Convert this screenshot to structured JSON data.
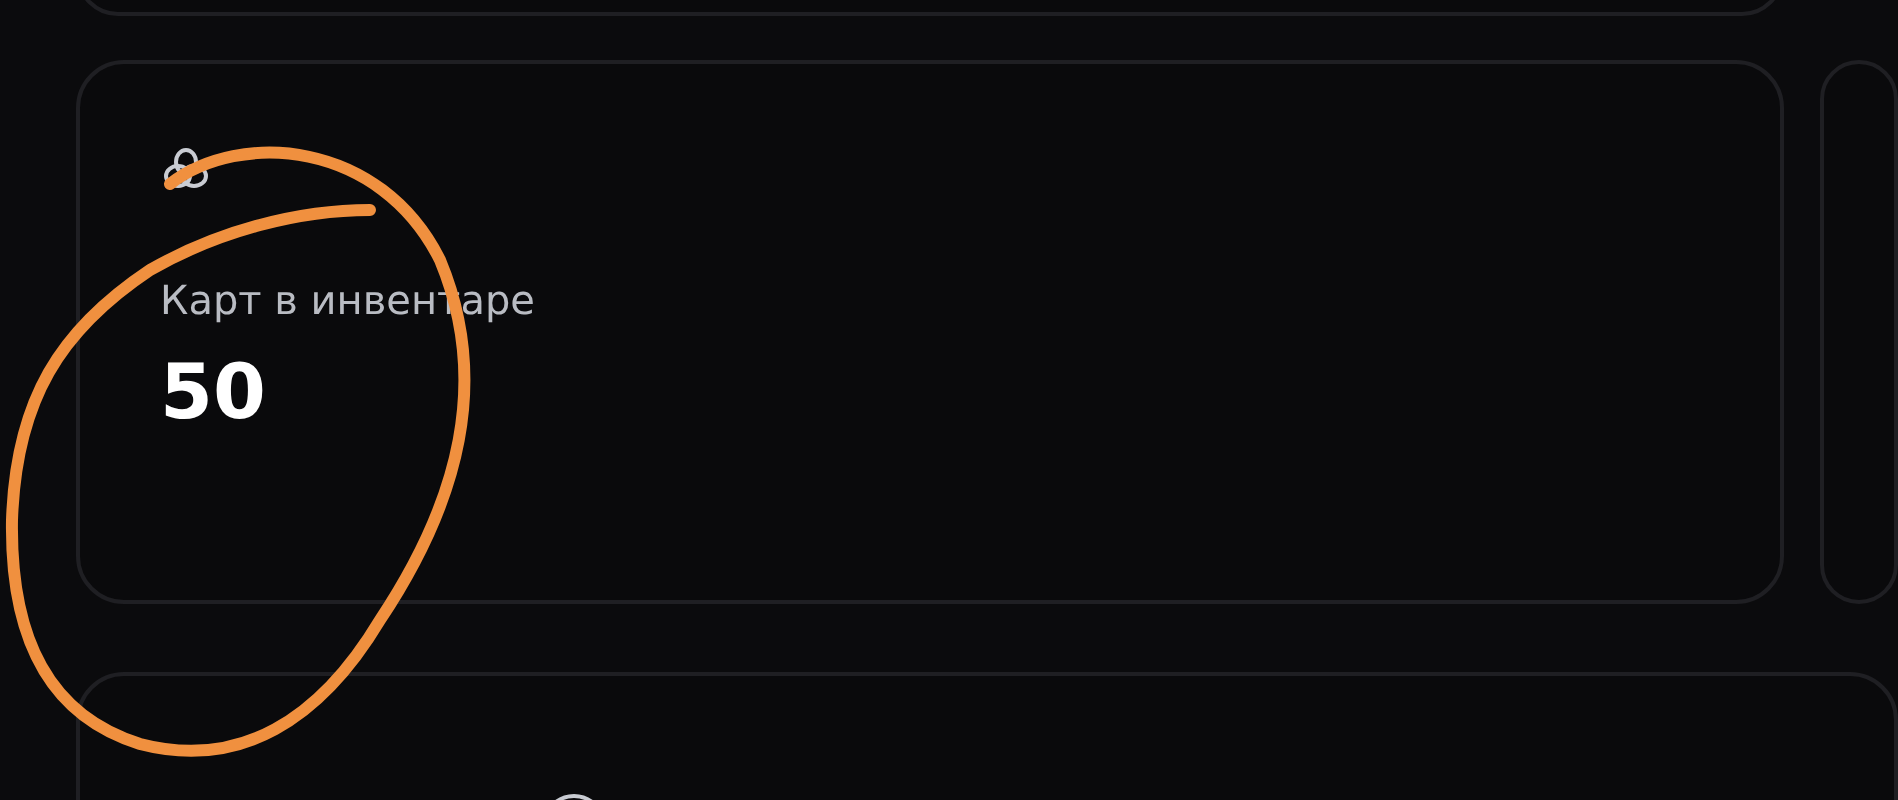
{
  "stat_card": {
    "label": "Карт в инвентаре",
    "value": "50"
  }
}
